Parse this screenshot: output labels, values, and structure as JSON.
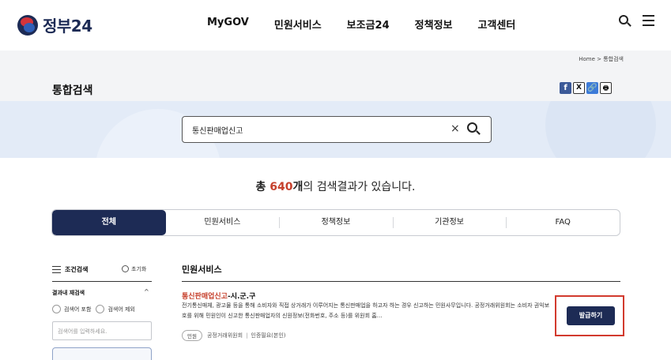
{
  "header": {
    "logo_text": "정부24",
    "nav": [
      "MyGOV",
      "민원서비스",
      "보조금24",
      "정책정보",
      "고객센터"
    ]
  },
  "breadcrumb": "Home > 통합검색",
  "page_title": "통합검색",
  "share": {
    "facebook": "f",
    "x": "X",
    "link": "🔗",
    "print": "🖶"
  },
  "search": {
    "value": "통신판매업신고",
    "clear": "×"
  },
  "result_count": {
    "prefix": "총 ",
    "number": "640",
    "unit": "개",
    "suffix": "의 검색결과가 있습니다."
  },
  "tabs": [
    "전체",
    "민원서비스",
    "정책정보",
    "기관정보",
    "FAQ"
  ],
  "filter": {
    "title": "조건검색",
    "reset": "초기화",
    "research_title": "결과내 재검색",
    "research_chevron": "^",
    "include": "검색어 포함",
    "exclude": "검색어 제외",
    "input_placeholder": "검색어를 입력하세요."
  },
  "results": {
    "section_title": "민원서비스",
    "items": [
      {
        "title_highlight": "통신판매업신고",
        "title_rest": "-시.군.구",
        "description": "전기통신매체, 광고물 등을 통해 소비자와 직접 상거래가 이루어지는 통신판매업을 하고자 하는 경우 신고하는 민원사무입니다. 공정거래위원회는 소비자 권익보호를 위해 민원인이 신고한 통신판매업자의 신원정보(전화번호, 주소 등)를 위원회 홈…",
        "badge": "민원",
        "agency": "공정거래위원회",
        "meta_sep": "|",
        "auth": "인증필요(본인)",
        "action": "발급하기"
      }
    ]
  }
}
